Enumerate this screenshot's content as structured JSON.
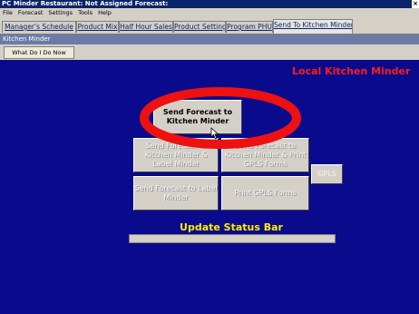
{
  "titlebar": {
    "title": "PC Minder   Restaurant: Not Assigned   Forecast:"
  },
  "menu": [
    "File",
    "Forecast",
    "Settings",
    "Tools",
    "Help"
  ],
  "tabs": [
    {
      "label": "Manager's Schedule"
    },
    {
      "label": "Product Mix"
    },
    {
      "label": "Half Hour Sales"
    },
    {
      "label": "Product Settings"
    },
    {
      "label": "Program PHU"
    },
    {
      "label": "Send To Kitchen Minder"
    }
  ],
  "subheader": "Kitchen Minder",
  "help_button": "What Do I Do Now",
  "panel": {
    "title": "Local Kitchen Minder",
    "buttons": {
      "send_km": "Send Forecast to Kitchen Minder",
      "send_km_label": "Send Forecast to Kitchen Minder & Label Minder",
      "send_km_gpls": "Send Forecast to Kitchen Minder & Print GPLS Forms",
      "gpls": "GPLS",
      "send_label": "Send Forecast to Label Minder",
      "print_gpls": "Print GPLS Forms"
    },
    "status_label": "Update Status Bar",
    "status_progress": 0
  },
  "colors": {
    "panel_bg": "#0a0a8c",
    "title_red": "#ff1a1a",
    "status_yellow": "#ffee00",
    "annotation_red": "#ee1111"
  }
}
